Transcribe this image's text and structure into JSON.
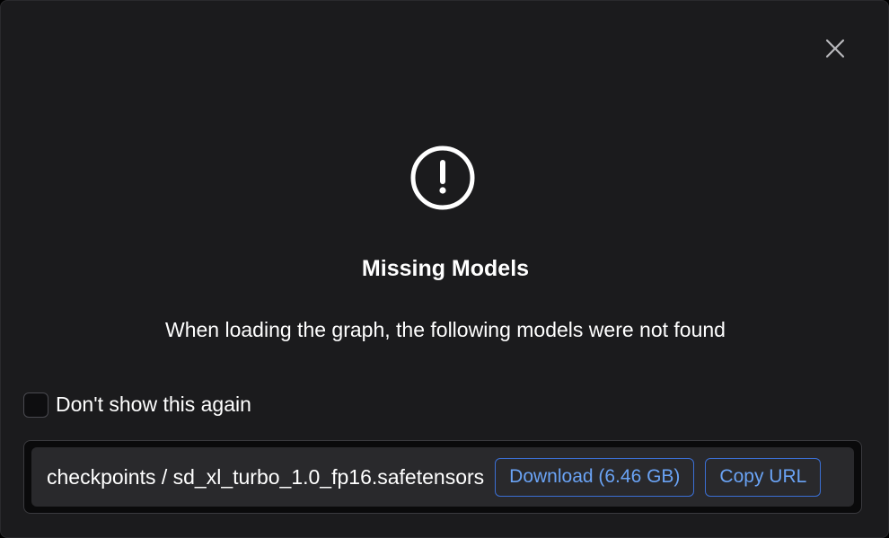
{
  "dialog": {
    "close_icon": "close-icon",
    "status_icon": "exclamation-circle-icon",
    "title": "Missing Models",
    "message": "When loading the graph, the following models were not found"
  },
  "dont_show": {
    "label": "Don't show this again",
    "checked": false
  },
  "models": [
    {
      "name": "checkpoints / sd_xl_turbo_1.0_fp16.safetensors",
      "download_label": "Download (6.46 GB)",
      "copy_label": "Copy URL"
    }
  ],
  "colors": {
    "background": "#1b1b1d",
    "item_background": "#29292c",
    "accent": "#6aa3f5",
    "accent_border": "#3b6fd4"
  }
}
